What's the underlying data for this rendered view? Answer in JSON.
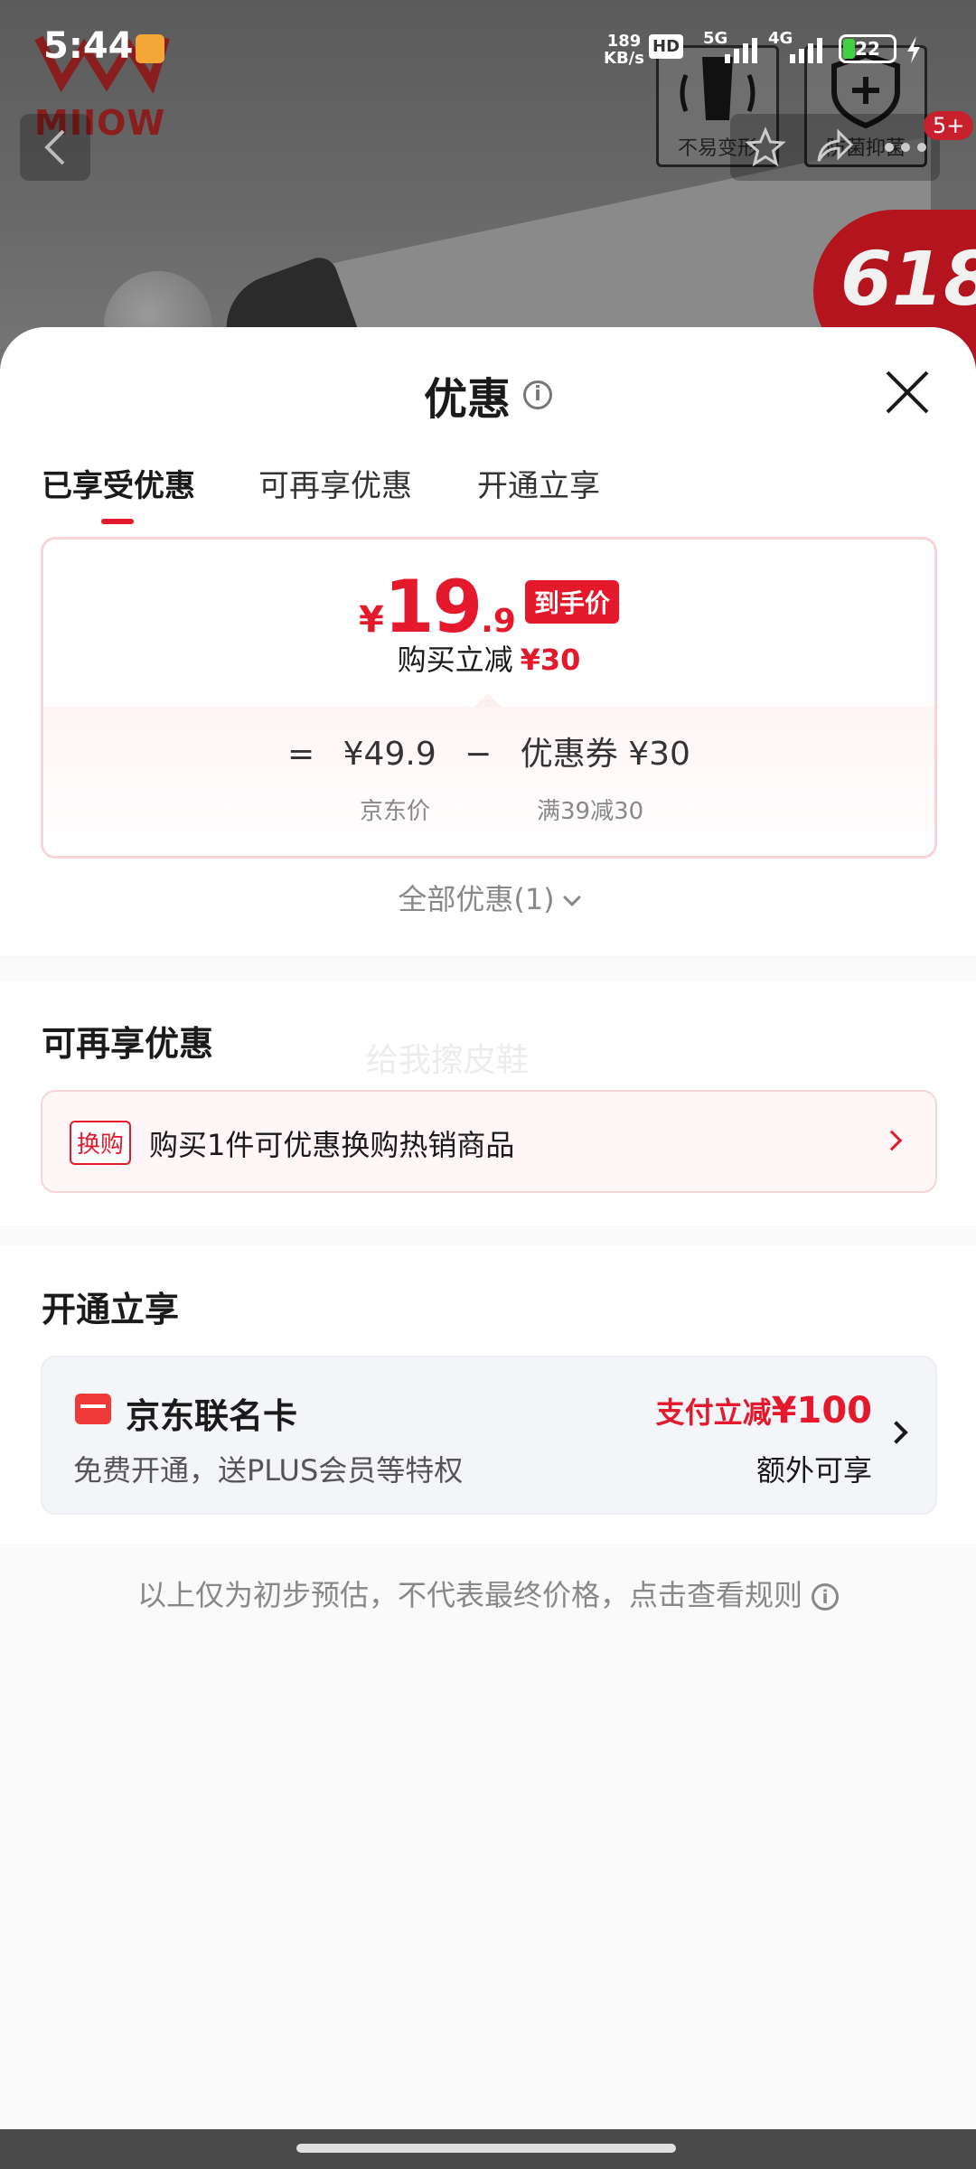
{
  "status_bar": {
    "time": "5:44",
    "speed_value": "189",
    "speed_unit": "KB/s",
    "hd": "HD",
    "net1": "5G",
    "net2": "4G",
    "battery": "22"
  },
  "background": {
    "brand": "MIIOW",
    "feature1": "不易变形",
    "feature2": "防菌抑菌",
    "cart_badge": "5+",
    "promo_badge": "618"
  },
  "sheet": {
    "title": "优惠",
    "tabs": [
      {
        "label": "已享受优惠",
        "active": true
      },
      {
        "label": "可再享优惠",
        "active": false
      },
      {
        "label": "开通立享",
        "active": false
      }
    ]
  },
  "price_card": {
    "currency": "¥",
    "price_int": "19",
    "price_dec": ".9",
    "price_tag": "到手价",
    "reduce_label": "购买立减",
    "reduce_amount": "¥30",
    "eq": "=",
    "jd_price": "¥49.9",
    "minus": "−",
    "coupon": "优惠券 ¥30",
    "jd_price_label": "京东价",
    "coupon_rule": "满39减30"
  },
  "all_promos": "全部优惠(1)",
  "more_section": {
    "title": "可再享优惠",
    "watermark": "给我擦皮鞋",
    "exchange_tag": "换购",
    "exchange_text": "购买1件可优惠换购热销商品"
  },
  "open_section": {
    "title": "开通立享",
    "card_name": "京东联名卡",
    "card_desc": "免费开通，送PLUS会员等特权",
    "pay_label": "支付立减",
    "pay_amount": "¥100",
    "extra": "额外可享"
  },
  "disclaimer": "以上仅为初步预估，不代表最终价格，点击查看规则",
  "colors": {
    "accent": "#e4192b",
    "card_bg": "#f4f5f9"
  }
}
